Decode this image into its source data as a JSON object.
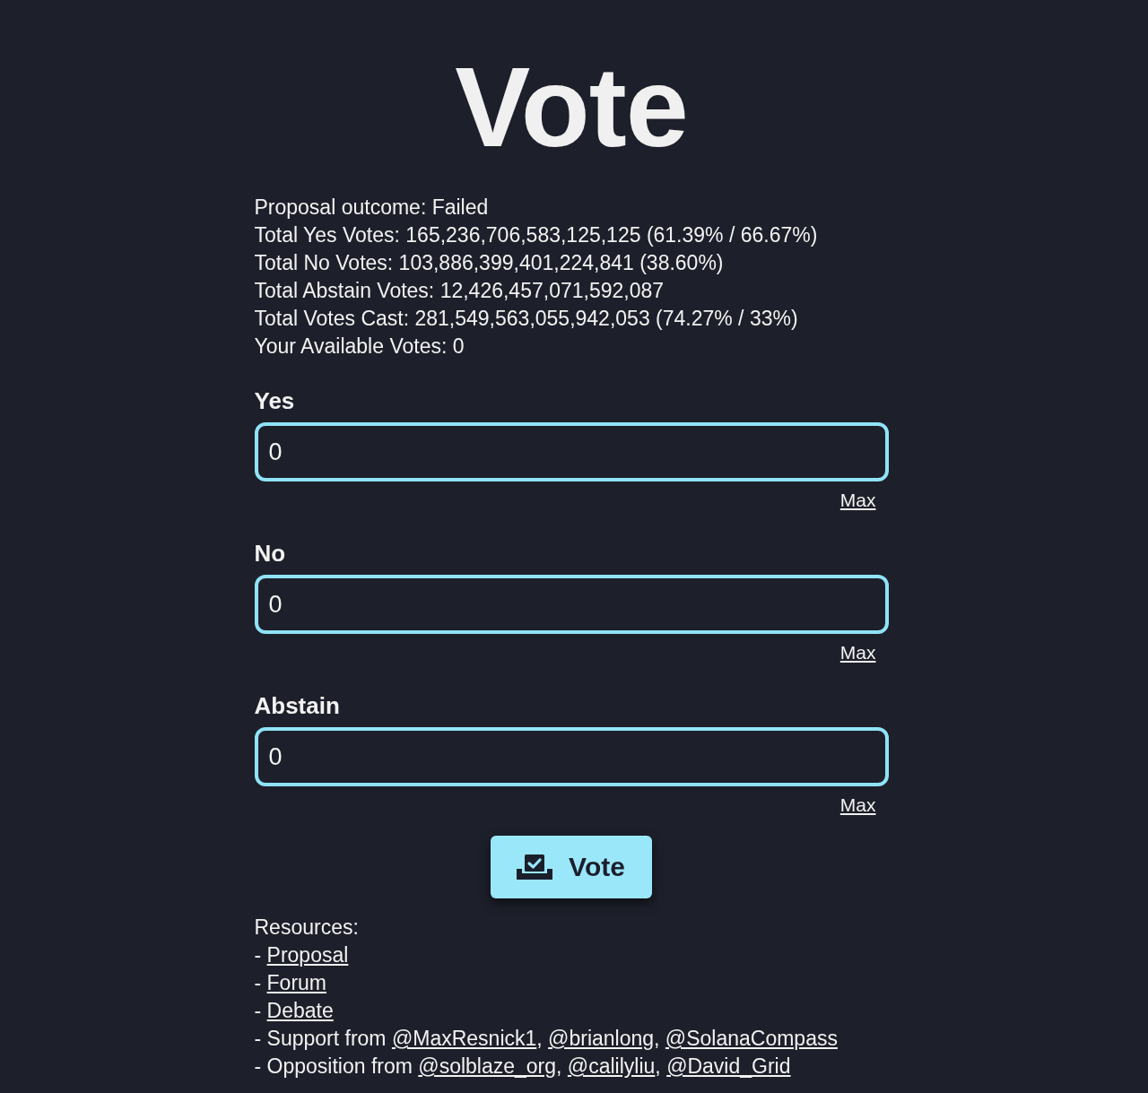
{
  "title": "Vote",
  "summary": [
    "Proposal outcome: Failed",
    "Total Yes Votes: 165,236,706,583,125,125 (61.39% / 66.67%)",
    "Total No Votes: 103,886,399,401,224,841 (38.60%)",
    "Total Abstain Votes: 12,426,457,071,592,087",
    "Total Votes Cast: 281,549,563,055,942,053 (74.27% / 33%)",
    "Your Available Votes: 0"
  ],
  "vote_fields": [
    {
      "label": "Yes",
      "value": "0",
      "max_link": "Max"
    },
    {
      "label": "No",
      "value": "0",
      "max_link": "Max"
    },
    {
      "label": "Abstain",
      "value": "0",
      "max_link": "Max"
    }
  ],
  "vote_button": {
    "label": "Vote"
  },
  "resources": {
    "heading": "Resources:",
    "lines": [
      {
        "prefix": "- ",
        "links": [
          "Proposal"
        ]
      },
      {
        "prefix": "- ",
        "links": [
          "Forum"
        ]
      },
      {
        "prefix": "- ",
        "links": [
          "Debate"
        ]
      },
      {
        "prefix": "- Support from ",
        "links": [
          "@MaxResnick1",
          "@brianlong",
          "@SolanaCompass"
        ],
        "separator": ", "
      },
      {
        "prefix": "- Opposition from ",
        "links": [
          "@solblaze_org",
          "@calilyliu",
          "@David_Grid"
        ],
        "separator": ", "
      }
    ]
  }
}
